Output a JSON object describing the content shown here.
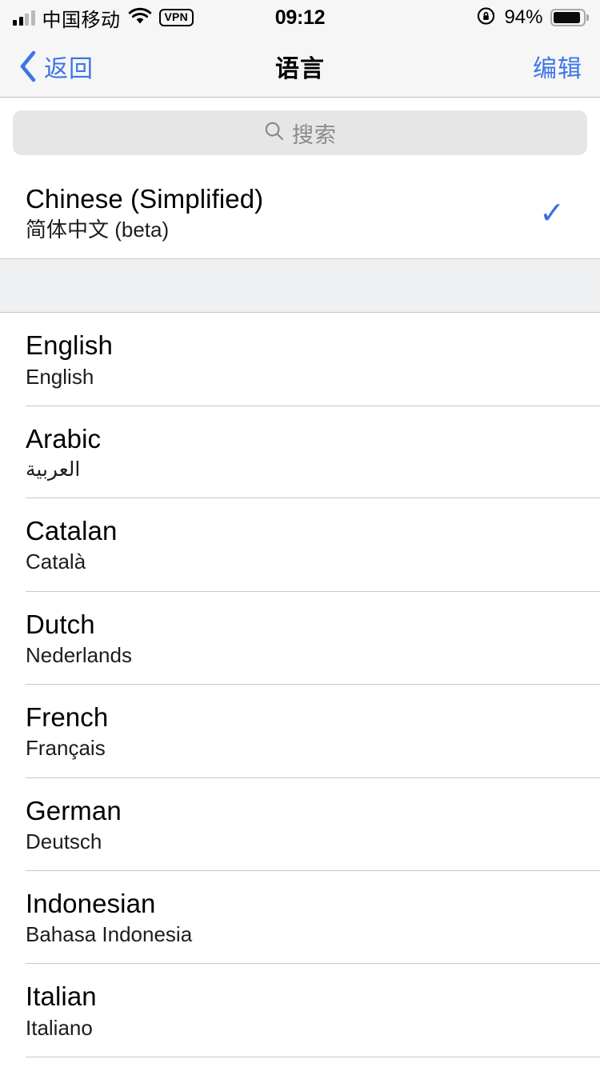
{
  "status_bar": {
    "carrier": "中国移动",
    "signal_icon": "cellular-signal-icon",
    "signal_bars_filled": 2,
    "signal_bars_total": 4,
    "wifi_icon": "wifi-icon",
    "vpn_label": "VPN",
    "time": "09:12",
    "rotation_lock_icon": "rotation-lock-icon",
    "battery_percent": "94%",
    "battery_level": 94,
    "battery_icon": "battery-icon"
  },
  "nav_bar": {
    "back_label": "返回",
    "back_icon": "chevron-left-icon",
    "title": "语言",
    "edit_label": "编辑",
    "accent_color": "#3b76e8"
  },
  "search": {
    "placeholder": "搜索",
    "icon": "search-icon",
    "value": ""
  },
  "selected_section": {
    "rows": [
      {
        "title": "Chinese (Simplified)",
        "subtitle": "简体中文 (beta)",
        "checked": true,
        "check_glyph": "✓",
        "check_color": "#3b70d8"
      }
    ]
  },
  "languages_section": {
    "rows": [
      {
        "title": "English",
        "subtitle": "English",
        "rtl": false
      },
      {
        "title": "Arabic",
        "subtitle": "العربية",
        "rtl": true
      },
      {
        "title": "Catalan",
        "subtitle": "Català",
        "rtl": false
      },
      {
        "title": "Dutch",
        "subtitle": "Nederlands",
        "rtl": false
      },
      {
        "title": "French",
        "subtitle": "Français",
        "rtl": false
      },
      {
        "title": "German",
        "subtitle": "Deutsch",
        "rtl": false
      },
      {
        "title": "Indonesian",
        "subtitle": "Bahasa Indonesia",
        "rtl": false
      },
      {
        "title": "Italian",
        "subtitle": "Italiano",
        "rtl": false
      }
    ]
  }
}
